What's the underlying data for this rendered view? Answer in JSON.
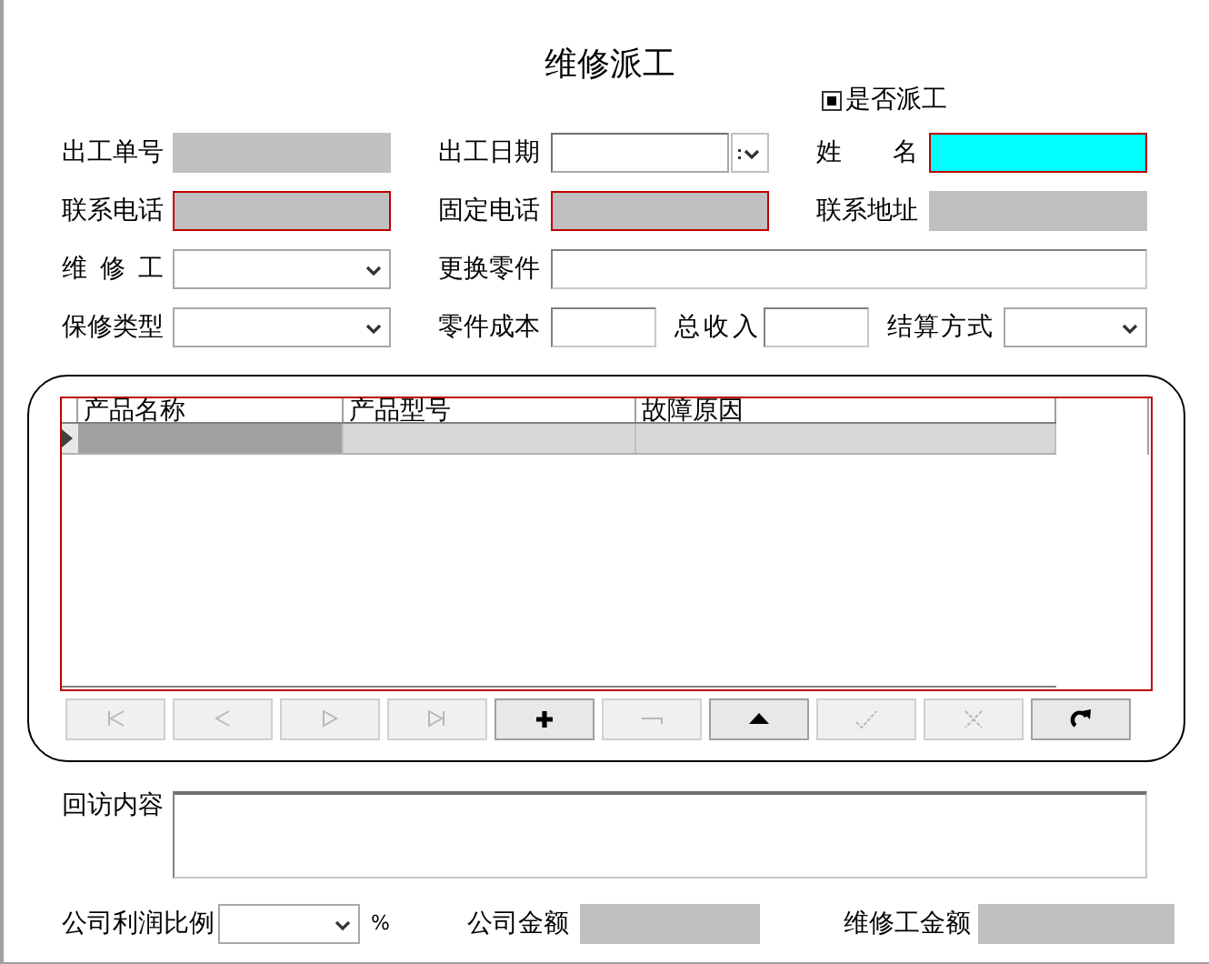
{
  "title": "维修派工",
  "dispatch": {
    "label": "是否派工",
    "checked": true
  },
  "form_rows": [
    [
      {
        "label": "出工单号",
        "kind": "readonly"
      },
      {
        "label": "出工日期",
        "kind": "date"
      },
      {
        "label": "姓 名",
        "kind": "text",
        "highlighted": true,
        "required": true
      }
    ],
    [
      {
        "label": "联系电话",
        "kind": "readonly",
        "required": true
      },
      {
        "label": "固定电话",
        "kind": "readonly",
        "required": true
      },
      {
        "label": "联系地址",
        "kind": "readonly"
      }
    ],
    [
      {
        "label": "维 修 工",
        "kind": "combo"
      },
      {
        "label": "更换零件",
        "kind": "text"
      }
    ],
    [
      {
        "label": "保修类型",
        "kind": "combo"
      },
      {
        "label": "零件成本",
        "kind": "text"
      },
      {
        "label": "总收入",
        "kind": "text"
      },
      {
        "label": "结算方式",
        "kind": "combo"
      }
    ]
  ],
  "grid": {
    "columns": [
      "产品名称",
      "产品型号",
      "故障原因"
    ],
    "rows": [
      {
        "selected": true
      }
    ]
  },
  "navigator": [
    {
      "kind": "first",
      "disabled": true
    },
    {
      "kind": "prior",
      "disabled": true
    },
    {
      "kind": "next",
      "disabled": true
    },
    {
      "kind": "last",
      "disabled": true
    },
    {
      "kind": "insert",
      "disabled": false
    },
    {
      "kind": "delete",
      "disabled": true
    },
    {
      "kind": "edit",
      "disabled": false
    },
    {
      "kind": "post",
      "disabled": true
    },
    {
      "kind": "cancel",
      "disabled": true
    },
    {
      "kind": "refresh",
      "disabled": false
    }
  ],
  "followup": {
    "label": "回访内容"
  },
  "totals": [
    {
      "label": "公司利润比例",
      "kind": "combo",
      "unit": "%"
    },
    {
      "label": "公司金额",
      "kind": "readonly"
    },
    {
      "label": "维修工金额",
      "kind": "readonly"
    }
  ]
}
